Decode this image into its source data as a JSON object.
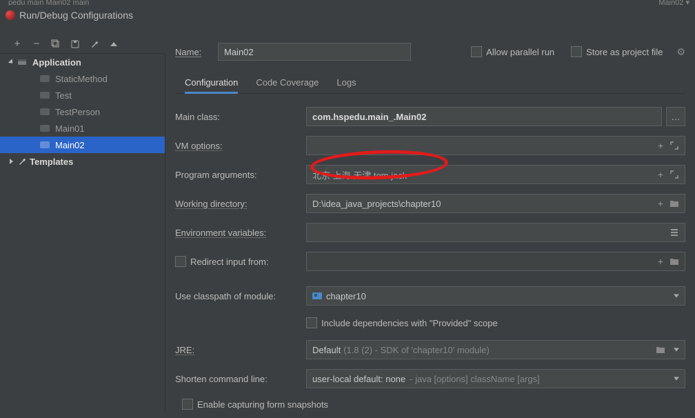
{
  "breadcrumb": "pedu  main  Main02  main",
  "dialog_title": "Run/Debug Configurations",
  "top_right_config": "Main02 ▾",
  "toolbar": {
    "add": "+",
    "remove": "−",
    "copy": "⧉",
    "save": "💾",
    "wrench": "🔧",
    "up": "▲"
  },
  "tree": {
    "root": "Application",
    "items": [
      "StaticMethod",
      "Test",
      "TestPerson",
      "Main01",
      "Main02"
    ],
    "selected_index": 4,
    "templates": "Templates"
  },
  "name": {
    "label": "Name:",
    "value": "Main02"
  },
  "options": {
    "allow_parallel": "Allow parallel run",
    "store_project": "Store as project file"
  },
  "tabs": [
    "Configuration",
    "Code Coverage",
    "Logs"
  ],
  "form": {
    "main_class_label": "Main class:",
    "main_class_value": "com.hspedu.main_.Main02",
    "vm_label": "VM options:",
    "vm_value": "",
    "args_label": "Program arguments:",
    "args_value": "北京 上海 天津 tom jack",
    "wd_label": "Working directory:",
    "wd_value": "D:\\idea_java_projects\\chapter10",
    "env_label": "Environment variables:",
    "env_value": "",
    "redirect_label": "Redirect input from:",
    "redirect_value": "",
    "cp_label": "Use classpath of module:",
    "cp_value": "chapter10",
    "include_deps": "Include dependencies with \"Provided\" scope",
    "jre_label": "JRE:",
    "jre_value": "Default",
    "jre_suffix": "(1.8 (2) - SDK of 'chapter10' module)",
    "shorten_label": "Shorten command line:",
    "shorten_value": "user-local default: none",
    "shorten_suffix": "- java [options] className [args]",
    "capture_snapshots": "Enable capturing form snapshots"
  }
}
